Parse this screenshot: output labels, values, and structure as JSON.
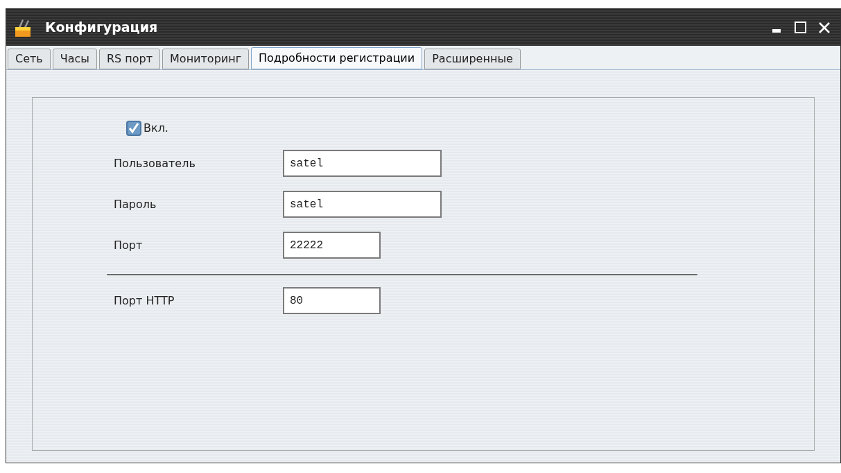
{
  "window": {
    "title": "Конфигурация"
  },
  "tabs": [
    {
      "label": "Сеть",
      "selected": false
    },
    {
      "label": "Часы",
      "selected": false
    },
    {
      "label": "RS порт",
      "selected": false
    },
    {
      "label": "Мониторинг",
      "selected": false
    },
    {
      "label": "Подробности регистрации",
      "selected": true
    },
    {
      "label": "Расширенные",
      "selected": false
    }
  ],
  "enabled": {
    "label": "Вкл.",
    "checked": true
  },
  "fields": [
    {
      "label": "Пользователь",
      "value": "satel",
      "kind": "text",
      "divider_before": false
    },
    {
      "label": "Пароль",
      "value": "satel",
      "kind": "text",
      "divider_before": false
    },
    {
      "label": "Порт",
      "value": "22222",
      "kind": "number",
      "divider_before": false
    },
    {
      "label": "Порт HTTP",
      "value": "80",
      "kind": "number",
      "divider_before": true
    }
  ]
}
